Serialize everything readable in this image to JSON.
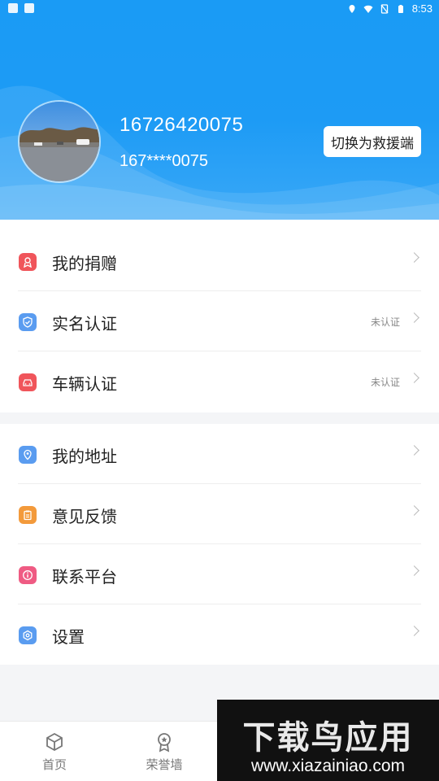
{
  "status_bar": {
    "time": "8:53"
  },
  "profile": {
    "phone": "16726420075",
    "masked_phone": "167****0075",
    "switch_button": "切换为救援端"
  },
  "menu": {
    "group1": [
      {
        "label": "我的捐赠",
        "status": "",
        "icon": "donation-icon",
        "color": "#f0555b"
      },
      {
        "label": "实名认证",
        "status": "未认证",
        "icon": "verified-shield-icon",
        "color": "#5a9cf0"
      },
      {
        "label": "车辆认证",
        "status": "未认证",
        "icon": "car-icon",
        "color": "#f0555b"
      }
    ],
    "group2": [
      {
        "label": "我的地址",
        "status": "",
        "icon": "location-icon",
        "color": "#5a9cf0"
      },
      {
        "label": "意见反馈",
        "status": "",
        "icon": "clipboard-icon",
        "color": "#f39a3b"
      },
      {
        "label": "联系平台",
        "status": "",
        "icon": "info-icon",
        "color": "#ef5b83"
      },
      {
        "label": "设置",
        "status": "",
        "icon": "settings-icon",
        "color": "#5a9cf0"
      }
    ]
  },
  "bottom_nav": [
    {
      "label": "首页",
      "icon": "box-icon"
    },
    {
      "label": "荣誉墙",
      "icon": "medal-icon"
    }
  ],
  "watermark": {
    "title": "下载鸟应用",
    "url": "www.xiazainiao.com"
  }
}
